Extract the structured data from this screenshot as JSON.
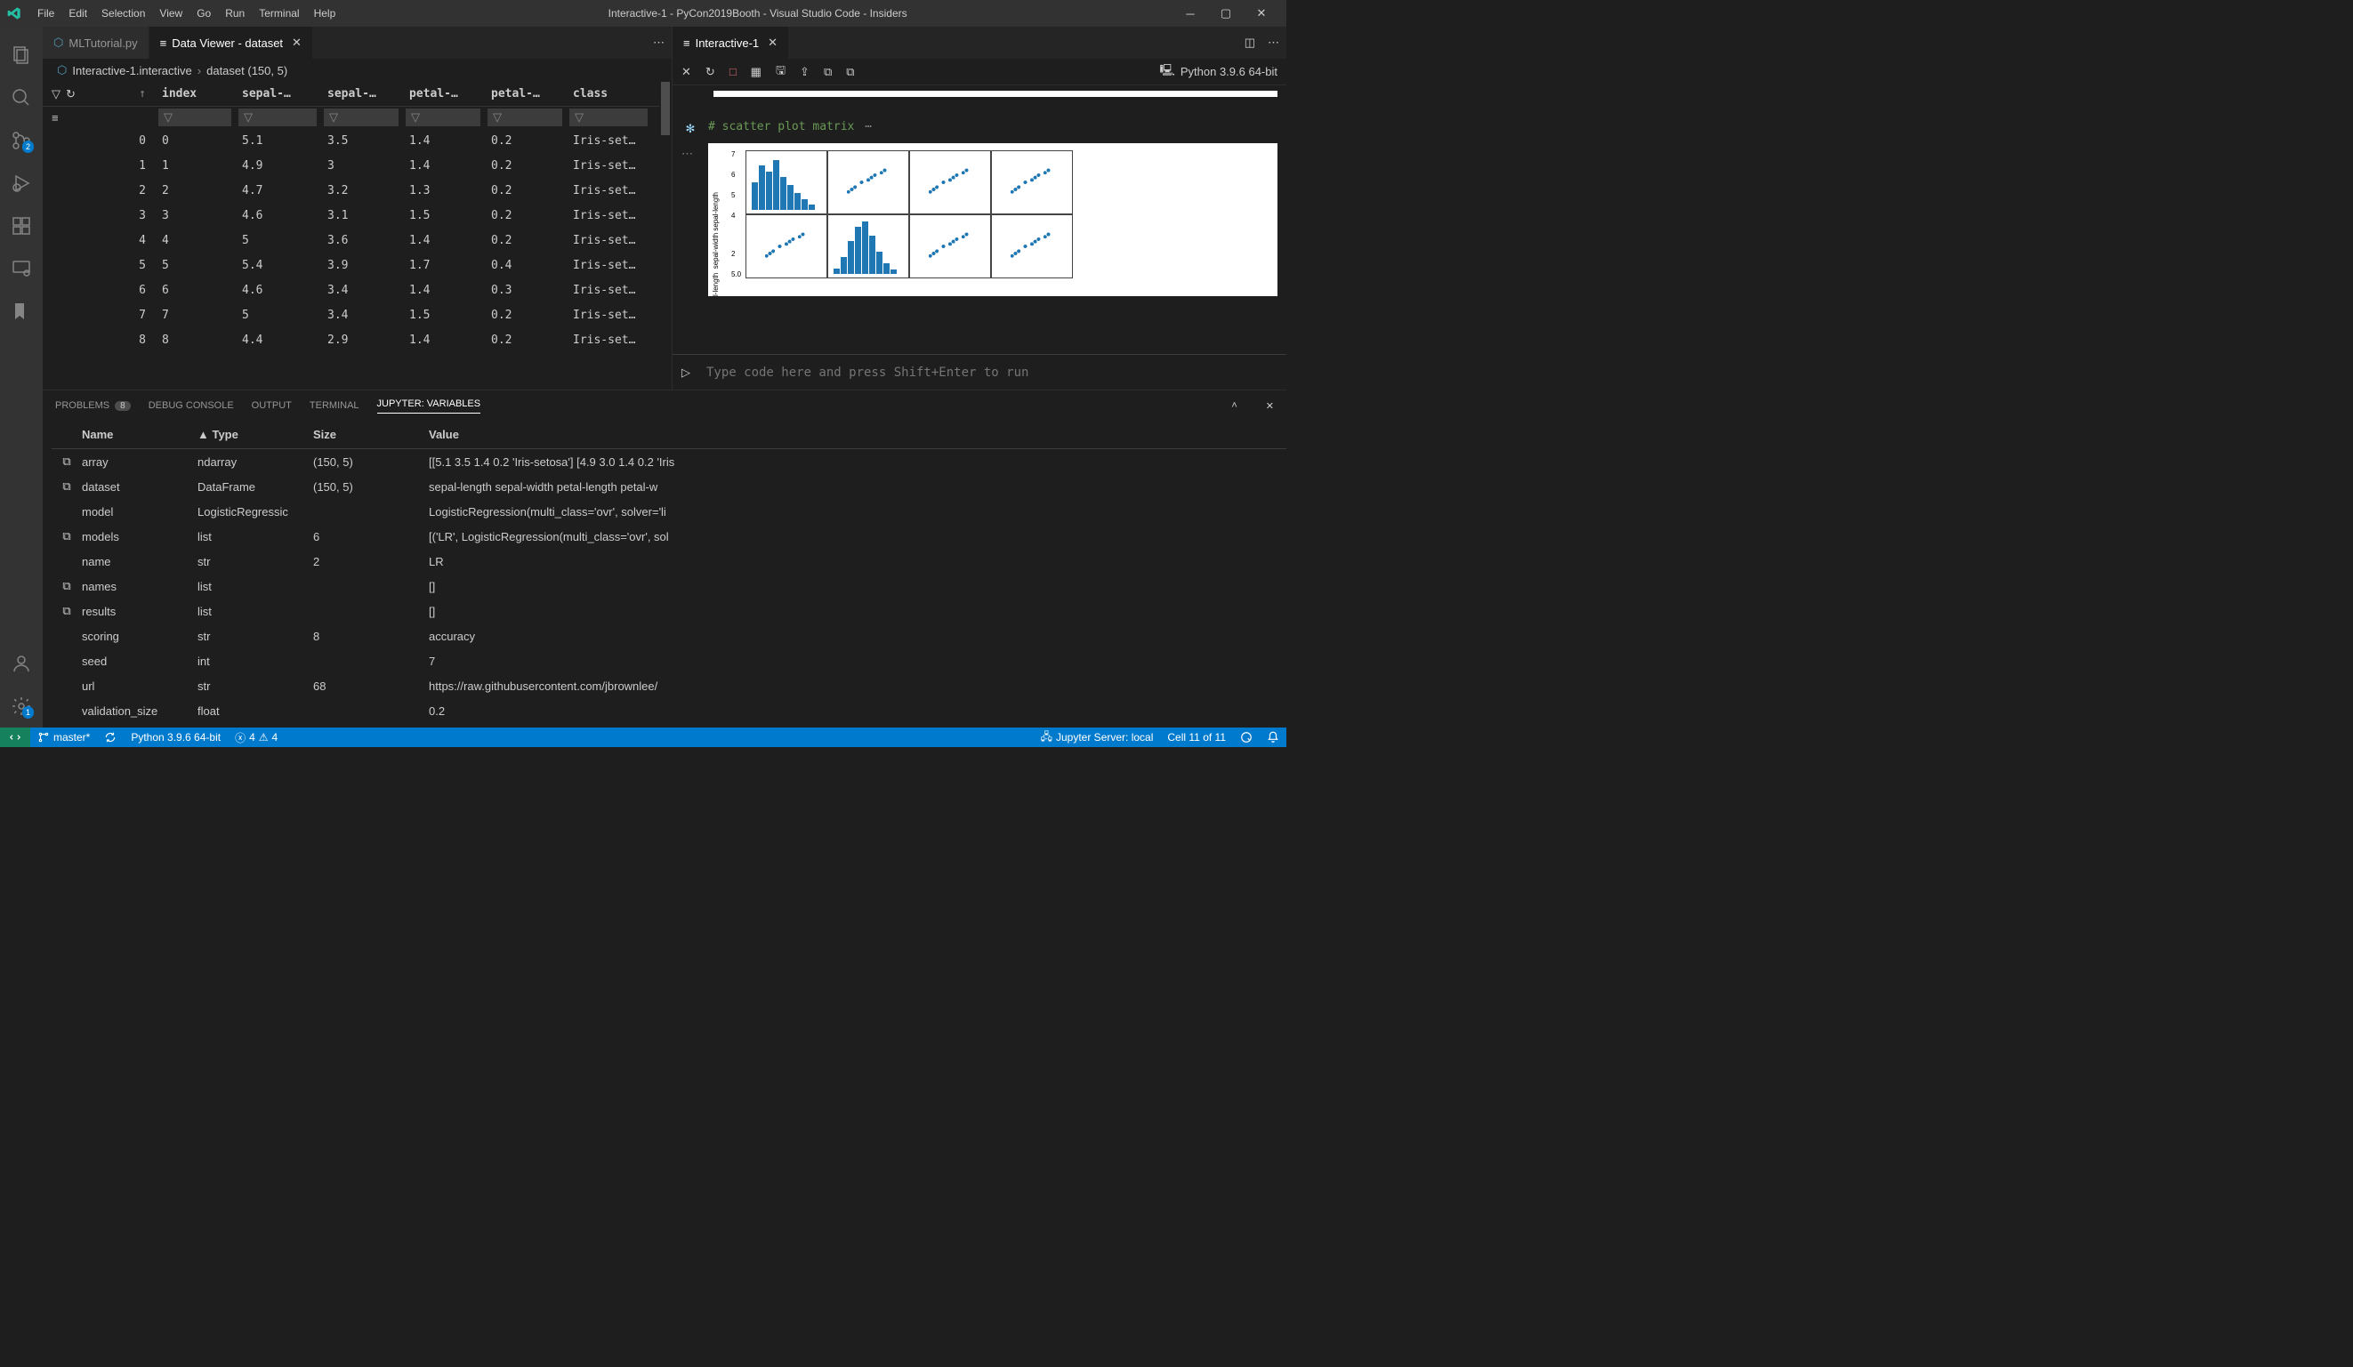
{
  "titlebar": {
    "title": "Interactive-1 - PyCon2019Booth - Visual Studio Code - Insiders",
    "menu": [
      "File",
      "Edit",
      "Selection",
      "View",
      "Go",
      "Run",
      "Terminal",
      "Help"
    ]
  },
  "activitybar": {
    "source_control_badge": "2",
    "settings_badge": "1"
  },
  "tabs_left": [
    {
      "label": "MLTutorial.py",
      "active": false,
      "icon": "python-file-icon"
    },
    {
      "label": "Data Viewer - dataset",
      "active": true,
      "icon": "data-icon",
      "closable": true
    }
  ],
  "tabs_right": [
    {
      "label": "Interactive-1",
      "active": true,
      "closable": true
    }
  ],
  "breadcrumb": {
    "file": "Interactive-1.interactive",
    "item": "dataset (150, 5)"
  },
  "data_viewer": {
    "columns": [
      "index",
      "sepal-…",
      "sepal-…",
      "petal-…",
      "petal-…",
      "class"
    ],
    "rows": [
      [
        "0",
        "0",
        "5.1",
        "3.5",
        "1.4",
        "0.2",
        "Iris-set…"
      ],
      [
        "1",
        "1",
        "4.9",
        "3",
        "1.4",
        "0.2",
        "Iris-set…"
      ],
      [
        "2",
        "2",
        "4.7",
        "3.2",
        "1.3",
        "0.2",
        "Iris-set…"
      ],
      [
        "3",
        "3",
        "4.6",
        "3.1",
        "1.5",
        "0.2",
        "Iris-set…"
      ],
      [
        "4",
        "4",
        "5",
        "3.6",
        "1.4",
        "0.2",
        "Iris-set…"
      ],
      [
        "5",
        "5",
        "5.4",
        "3.9",
        "1.7",
        "0.4",
        "Iris-set…"
      ],
      [
        "6",
        "6",
        "4.6",
        "3.4",
        "1.4",
        "0.3",
        "Iris-set…"
      ],
      [
        "7",
        "7",
        "5",
        "3.4",
        "1.5",
        "0.2",
        "Iris-set…"
      ],
      [
        "8",
        "8",
        "4.4",
        "2.9",
        "1.4",
        "0.2",
        "Iris-set…"
      ]
    ]
  },
  "interactive": {
    "code_comment": "# scatter plot matrix",
    "input_placeholder": "Type code here and press Shift+Enter to run",
    "python_label": "Python 3.9.6 64-bit",
    "plot_ylabels": [
      "sepal-length",
      "sepal-width",
      "l-length"
    ],
    "plot_ticks1": [
      "7",
      "6",
      "5"
    ],
    "plot_ticks2": [
      "4",
      "2"
    ],
    "plot_ticks3": [
      "5.0"
    ]
  },
  "panel": {
    "tabs": [
      {
        "label": "PROBLEMS",
        "count": "8"
      },
      {
        "label": "DEBUG CONSOLE"
      },
      {
        "label": "OUTPUT"
      },
      {
        "label": "TERMINAL"
      },
      {
        "label": "JUPYTER: VARIABLES",
        "active": true
      }
    ],
    "vars_headers": {
      "name": "Name",
      "type": "▲ Type",
      "size": "Size",
      "value": "Value"
    },
    "variables": [
      {
        "expand": true,
        "name": "array",
        "type": "ndarray",
        "size": "(150, 5)",
        "value": "[[5.1 3.5 1.4 0.2 'Iris-setosa'] [4.9 3.0 1.4 0.2 'Iris"
      },
      {
        "expand": true,
        "name": "dataset",
        "type": "DataFrame",
        "size": "(150, 5)",
        "value": "sepal-length sepal-width petal-length petal-w"
      },
      {
        "expand": false,
        "name": "model",
        "type": "LogisticRegressic",
        "size": "",
        "value": "LogisticRegression(multi_class='ovr', solver='li"
      },
      {
        "expand": true,
        "name": "models",
        "type": "list",
        "size": "6",
        "value": "[('LR', LogisticRegression(multi_class='ovr', sol"
      },
      {
        "expand": false,
        "name": "name",
        "type": "str",
        "size": "2",
        "value": "LR"
      },
      {
        "expand": true,
        "name": "names",
        "type": "list",
        "size": "",
        "value": "[]"
      },
      {
        "expand": true,
        "name": "results",
        "type": "list",
        "size": "",
        "value": "[]"
      },
      {
        "expand": false,
        "name": "scoring",
        "type": "str",
        "size": "8",
        "value": "accuracy"
      },
      {
        "expand": false,
        "name": "seed",
        "type": "int",
        "size": "",
        "value": "7"
      },
      {
        "expand": false,
        "name": "url",
        "type": "str",
        "size": "68",
        "value": "https://raw.githubusercontent.com/jbrownlee/"
      },
      {
        "expand": false,
        "name": "validation_size",
        "type": "float",
        "size": "",
        "value": "0.2"
      }
    ]
  },
  "statusbar": {
    "branch": "master*",
    "python": "Python 3.9.6 64-bit",
    "errors": "4",
    "warnings": "4",
    "jupyter": "Jupyter Server: local",
    "cell": "Cell 11 of 11"
  }
}
